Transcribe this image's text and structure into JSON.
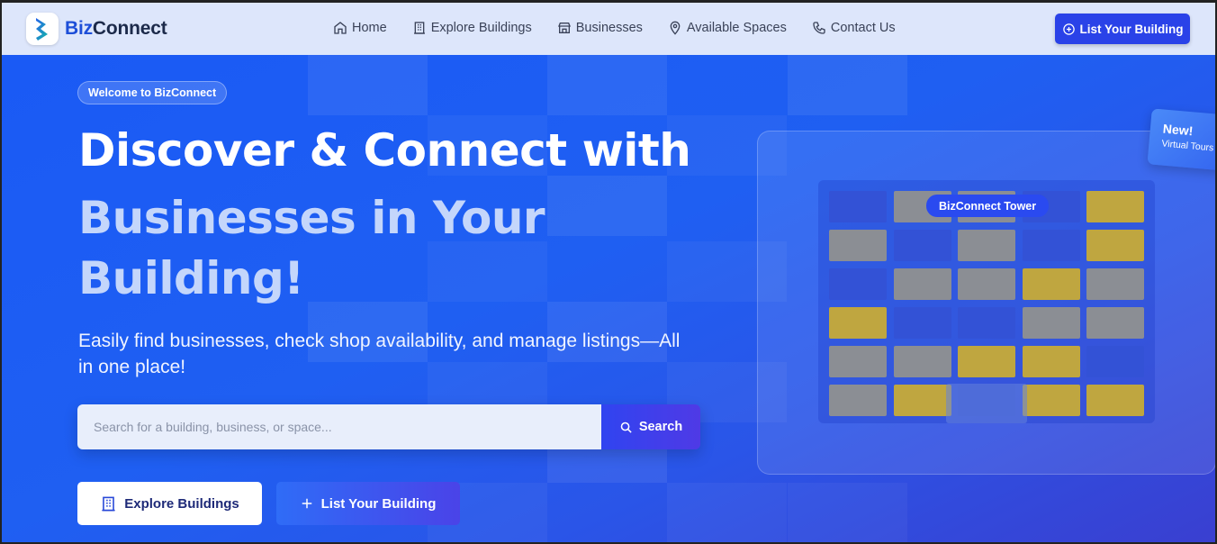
{
  "brand": {
    "prefix": "Biz",
    "suffix": "Connect"
  },
  "nav": {
    "items": [
      {
        "label": "Home",
        "icon": "home-icon"
      },
      {
        "label": "Explore Buildings",
        "icon": "building-icon"
      },
      {
        "label": "Businesses",
        "icon": "store-icon"
      },
      {
        "label": "Available Spaces",
        "icon": "map-pin-icon"
      },
      {
        "label": "Contact Us",
        "icon": "phone-icon"
      }
    ],
    "cta_label": "List Your Building"
  },
  "hero": {
    "badge": "Welcome to BizConnect",
    "title_line1": "Discover & Connect with",
    "title_line2": "Businesses in Your",
    "title_line3": "Building!",
    "subtitle": "Easily find businesses, check shop availability, and manage listings—All in one place!",
    "search": {
      "placeholder": "Search for a building, business, or space...",
      "value": "",
      "button_label": "Search"
    },
    "primary_button": "Explore Buildings",
    "secondary_button": "List Your Building"
  },
  "building_card": {
    "label": "BizConnect Tower",
    "new_badge_title": "New!",
    "new_badge_subtitle": "Virtual Tours",
    "window_grid": [
      [
        "b",
        "g",
        "g",
        "b",
        "y"
      ],
      [
        "g",
        "b",
        "g",
        "b",
        "y"
      ],
      [
        "b",
        "g",
        "g",
        "y",
        "g"
      ],
      [
        "y",
        "b",
        "b",
        "g",
        "g"
      ],
      [
        "g",
        "g",
        "y",
        "y",
        "b"
      ],
      [
        "g",
        "y",
        "b",
        "y",
        "y"
      ]
    ]
  },
  "colors": {
    "primary": "#2a42e8",
    "hero_bg": "#1c5cf2",
    "window_blue": "#3352d6",
    "window_gray": "#8b8e94",
    "window_yellow": "#bfa640"
  }
}
